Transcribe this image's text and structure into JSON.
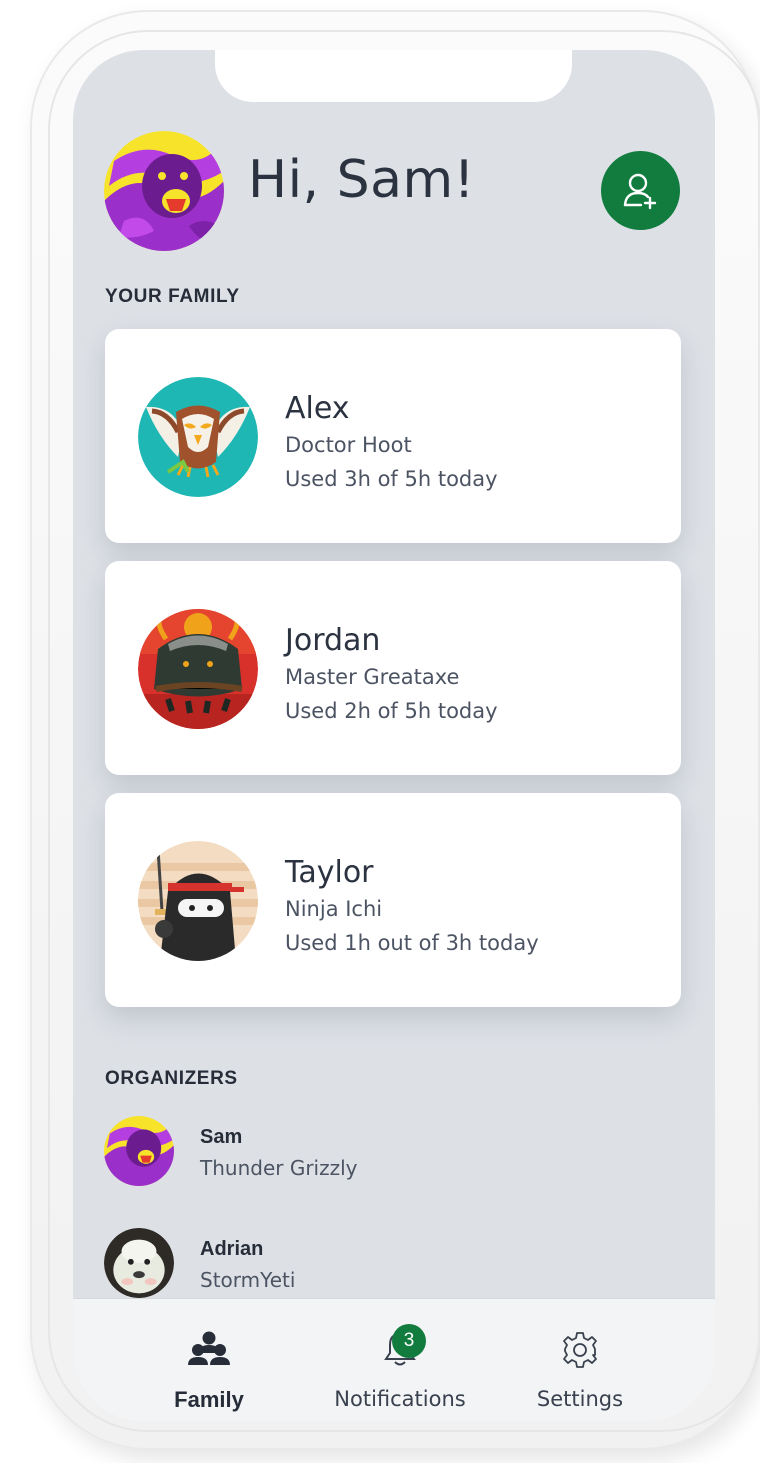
{
  "header": {
    "greeting": "Hi, Sam!",
    "avatar_icon": "grizzly-avatar",
    "add_member_icon": "add-person-icon"
  },
  "family": {
    "section_label": "YOUR FAMILY",
    "members": [
      {
        "name": "Alex",
        "gamertag": "Doctor Hoot",
        "usage": "Used 3h of 5h today",
        "avatar_icon": "owl-avatar"
      },
      {
        "name": "Jordan",
        "gamertag": "Master Greataxe",
        "usage": "Used 2h of 5h today",
        "avatar_icon": "viking-monster-avatar"
      },
      {
        "name": "Taylor",
        "gamertag": "Ninja Ichi",
        "usage": "Used 1h out of 3h today",
        "avatar_icon": "ninja-avatar"
      }
    ]
  },
  "organizers": {
    "section_label": "ORGANIZERS",
    "people": [
      {
        "name": "Sam",
        "gamertag": "Thunder Grizzly",
        "avatar_icon": "grizzly-avatar"
      },
      {
        "name": "Adrian",
        "gamertag": "StormYeti",
        "avatar_icon": "yeti-avatar"
      }
    ]
  },
  "nav": {
    "items": [
      {
        "label": "Family",
        "icon": "family-icon",
        "active": true
      },
      {
        "label": "Notifications",
        "icon": "bell-icon",
        "badge": "3"
      },
      {
        "label": "Settings",
        "icon": "gear-icon"
      }
    ]
  },
  "colors": {
    "accent": "#117c3e",
    "screen_bg": "#dde1e6",
    "card_bg": "#ffffff",
    "text": "#2b3240"
  }
}
